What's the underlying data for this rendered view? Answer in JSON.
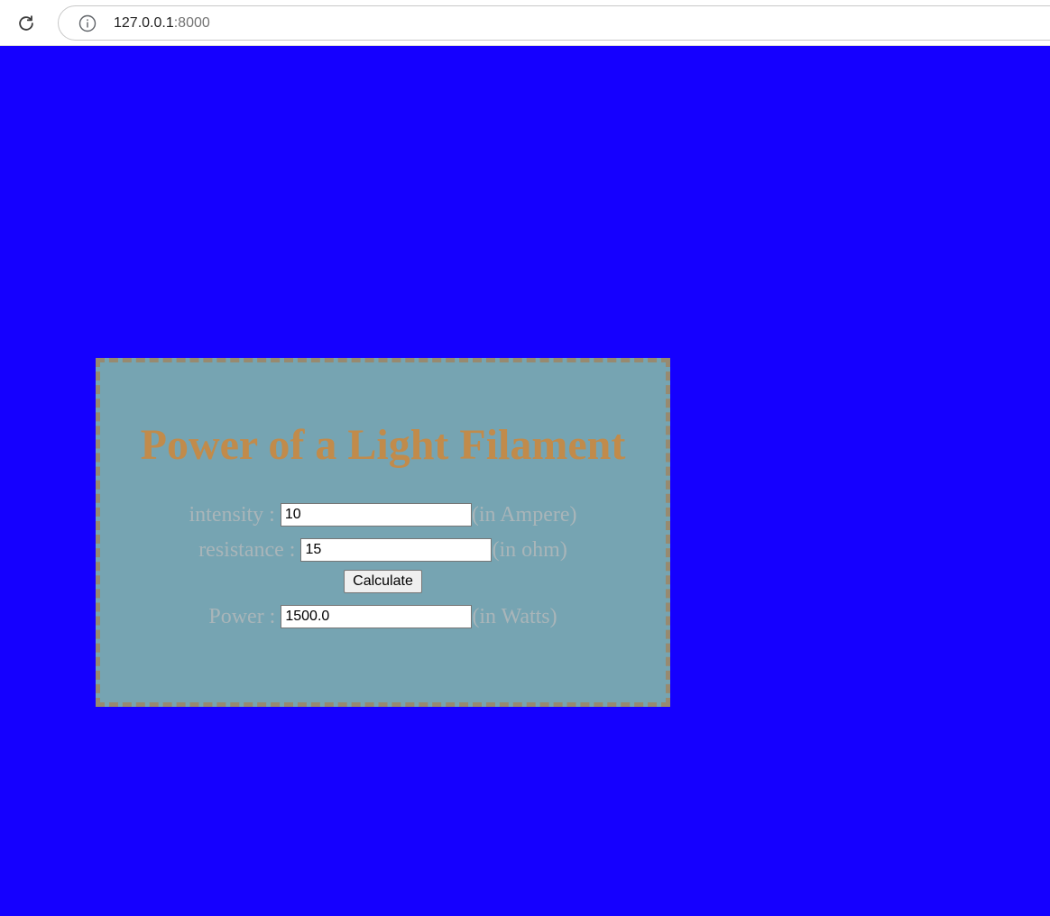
{
  "browser": {
    "url_host": "127.0.0.1",
    "url_port": ":8000"
  },
  "page": {
    "title": "Power of a Light Filament",
    "intensity": {
      "label": "intensity :",
      "value": "10",
      "unit": "(in Ampere)"
    },
    "resistance": {
      "label": "resistance :",
      "value": "15",
      "unit": "(in ohm)"
    },
    "calculate_label": "Calculate",
    "power": {
      "label": "Power :",
      "value": "1500.0",
      "unit": "(in Watts)"
    }
  },
  "colors": {
    "page_background": "#1500ff",
    "card_background": "#76a4b2",
    "card_border": "#978a70",
    "title_color": "#c18b4b",
    "label_color": "#a9b5b9"
  },
  "icons": {
    "reload": "reload-icon",
    "info": "info-icon"
  }
}
